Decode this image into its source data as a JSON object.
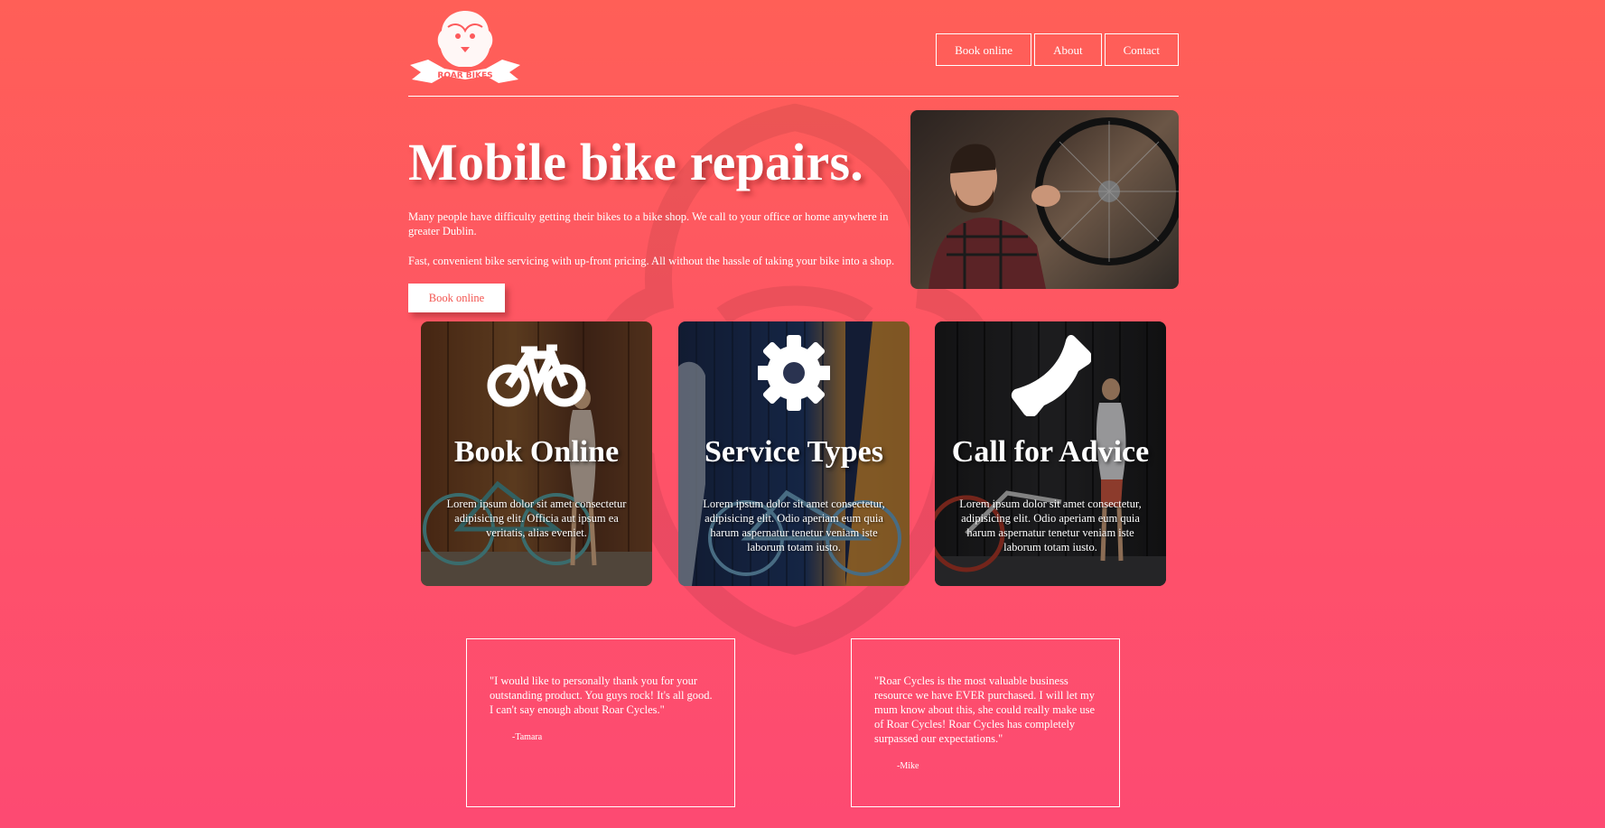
{
  "brand": {
    "logo_text": "ROAR BIKES"
  },
  "nav": {
    "items": [
      "Book online",
      "About",
      "Contact"
    ]
  },
  "hero": {
    "title": "Mobile bike repairs.",
    "paragraph1": "Many people have difficulty getting their bikes to a bike shop. We call to your office or home anywhere in greater Dublin.",
    "paragraph2": "Fast, convenient bike servicing with up-front pricing. All without the hassle of taking your bike into a shop.",
    "button": "Book online"
  },
  "cards": [
    {
      "title": "Book Online",
      "icon": "bicycle-icon",
      "text": "Lorem ipsum dolor sit amet consectetur adipisicing elit. Officia aut ipsum ea veritatis, alias eveniet."
    },
    {
      "title": "Service Types",
      "icon": "gear-icon",
      "text": "Lorem ipsum dolor sit amet consectetur, adipisicing elit. Odio aperiam eum quia harum aspernatur tenetur veniam iste laborum totam iusto."
    },
    {
      "title": "Call for Advice",
      "icon": "phone-icon",
      "text": "Lorem ipsum dolor sit amet consectetur, adipisicing elit. Odio aperiam eum quia harum aspernatur tenetur veniam iste laborum totam iusto."
    }
  ],
  "testimonials": [
    {
      "quote": "\"I would like to personally thank you for your outstanding product. You guys rock! It's all good. I can't say enough about Roar Cycles.\"",
      "author": "-Tamara"
    },
    {
      "quote": "\"Roar Cycles is the most valuable business resource we have EVER purchased. I will let my mum know about this, she could really make use of Roar Cycles! Roar Cycles has completely surpassed our expectations.\"",
      "author": "-Mike"
    }
  ],
  "colors": {
    "accent": "#f3544f",
    "bg_top": "#ff5f57",
    "bg_bottom": "#fd4a72"
  }
}
